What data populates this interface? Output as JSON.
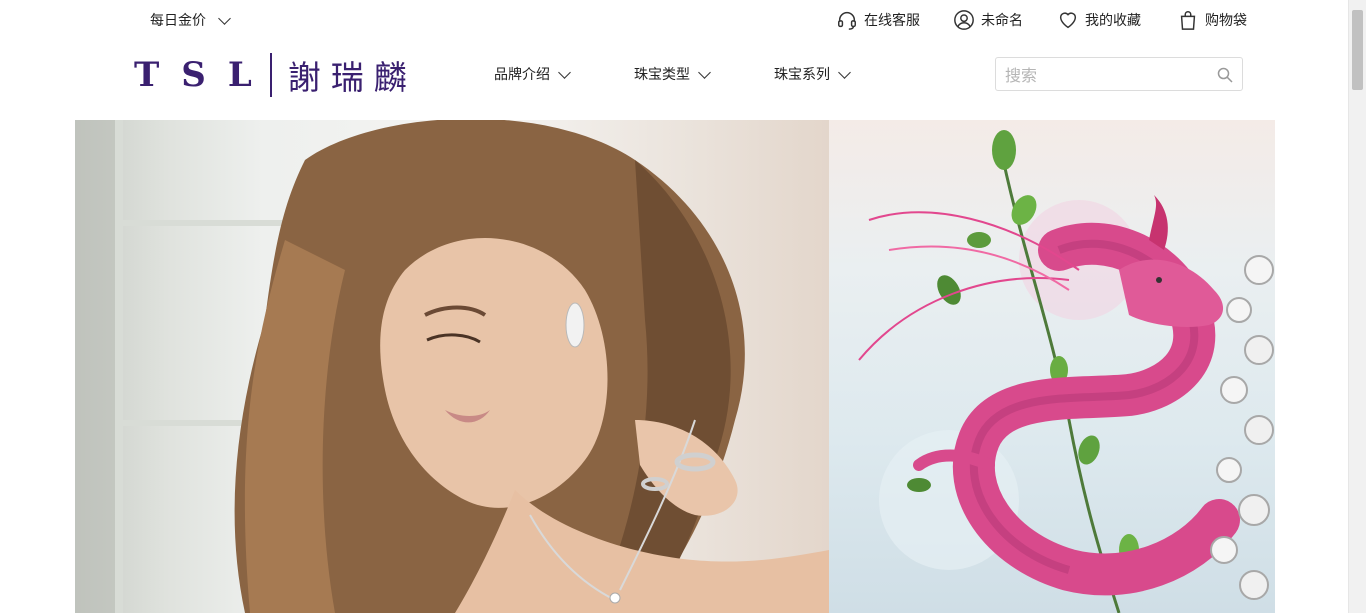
{
  "topbar": {
    "gold_price_label": "每日金价",
    "service_label": "在线客服",
    "account_label": "未命名",
    "favorites_label": "我的收藏",
    "bag_label": "购物袋"
  },
  "logo": {
    "en": "TSL",
    "cn": "謝瑞麟"
  },
  "nav": {
    "items": [
      {
        "label": "品牌介绍"
      },
      {
        "label": "珠宝类型"
      },
      {
        "label": "珠宝系列"
      }
    ]
  },
  "search": {
    "placeholder": "搜索",
    "value": ""
  },
  "colors": {
    "brand": "#3a2070",
    "dragon": "#d84a8c",
    "text": "#222222"
  },
  "icons": [
    "chevron-down-icon",
    "headset-icon",
    "user-icon",
    "heart-icon",
    "shopping-bag-icon",
    "search-icon"
  ]
}
